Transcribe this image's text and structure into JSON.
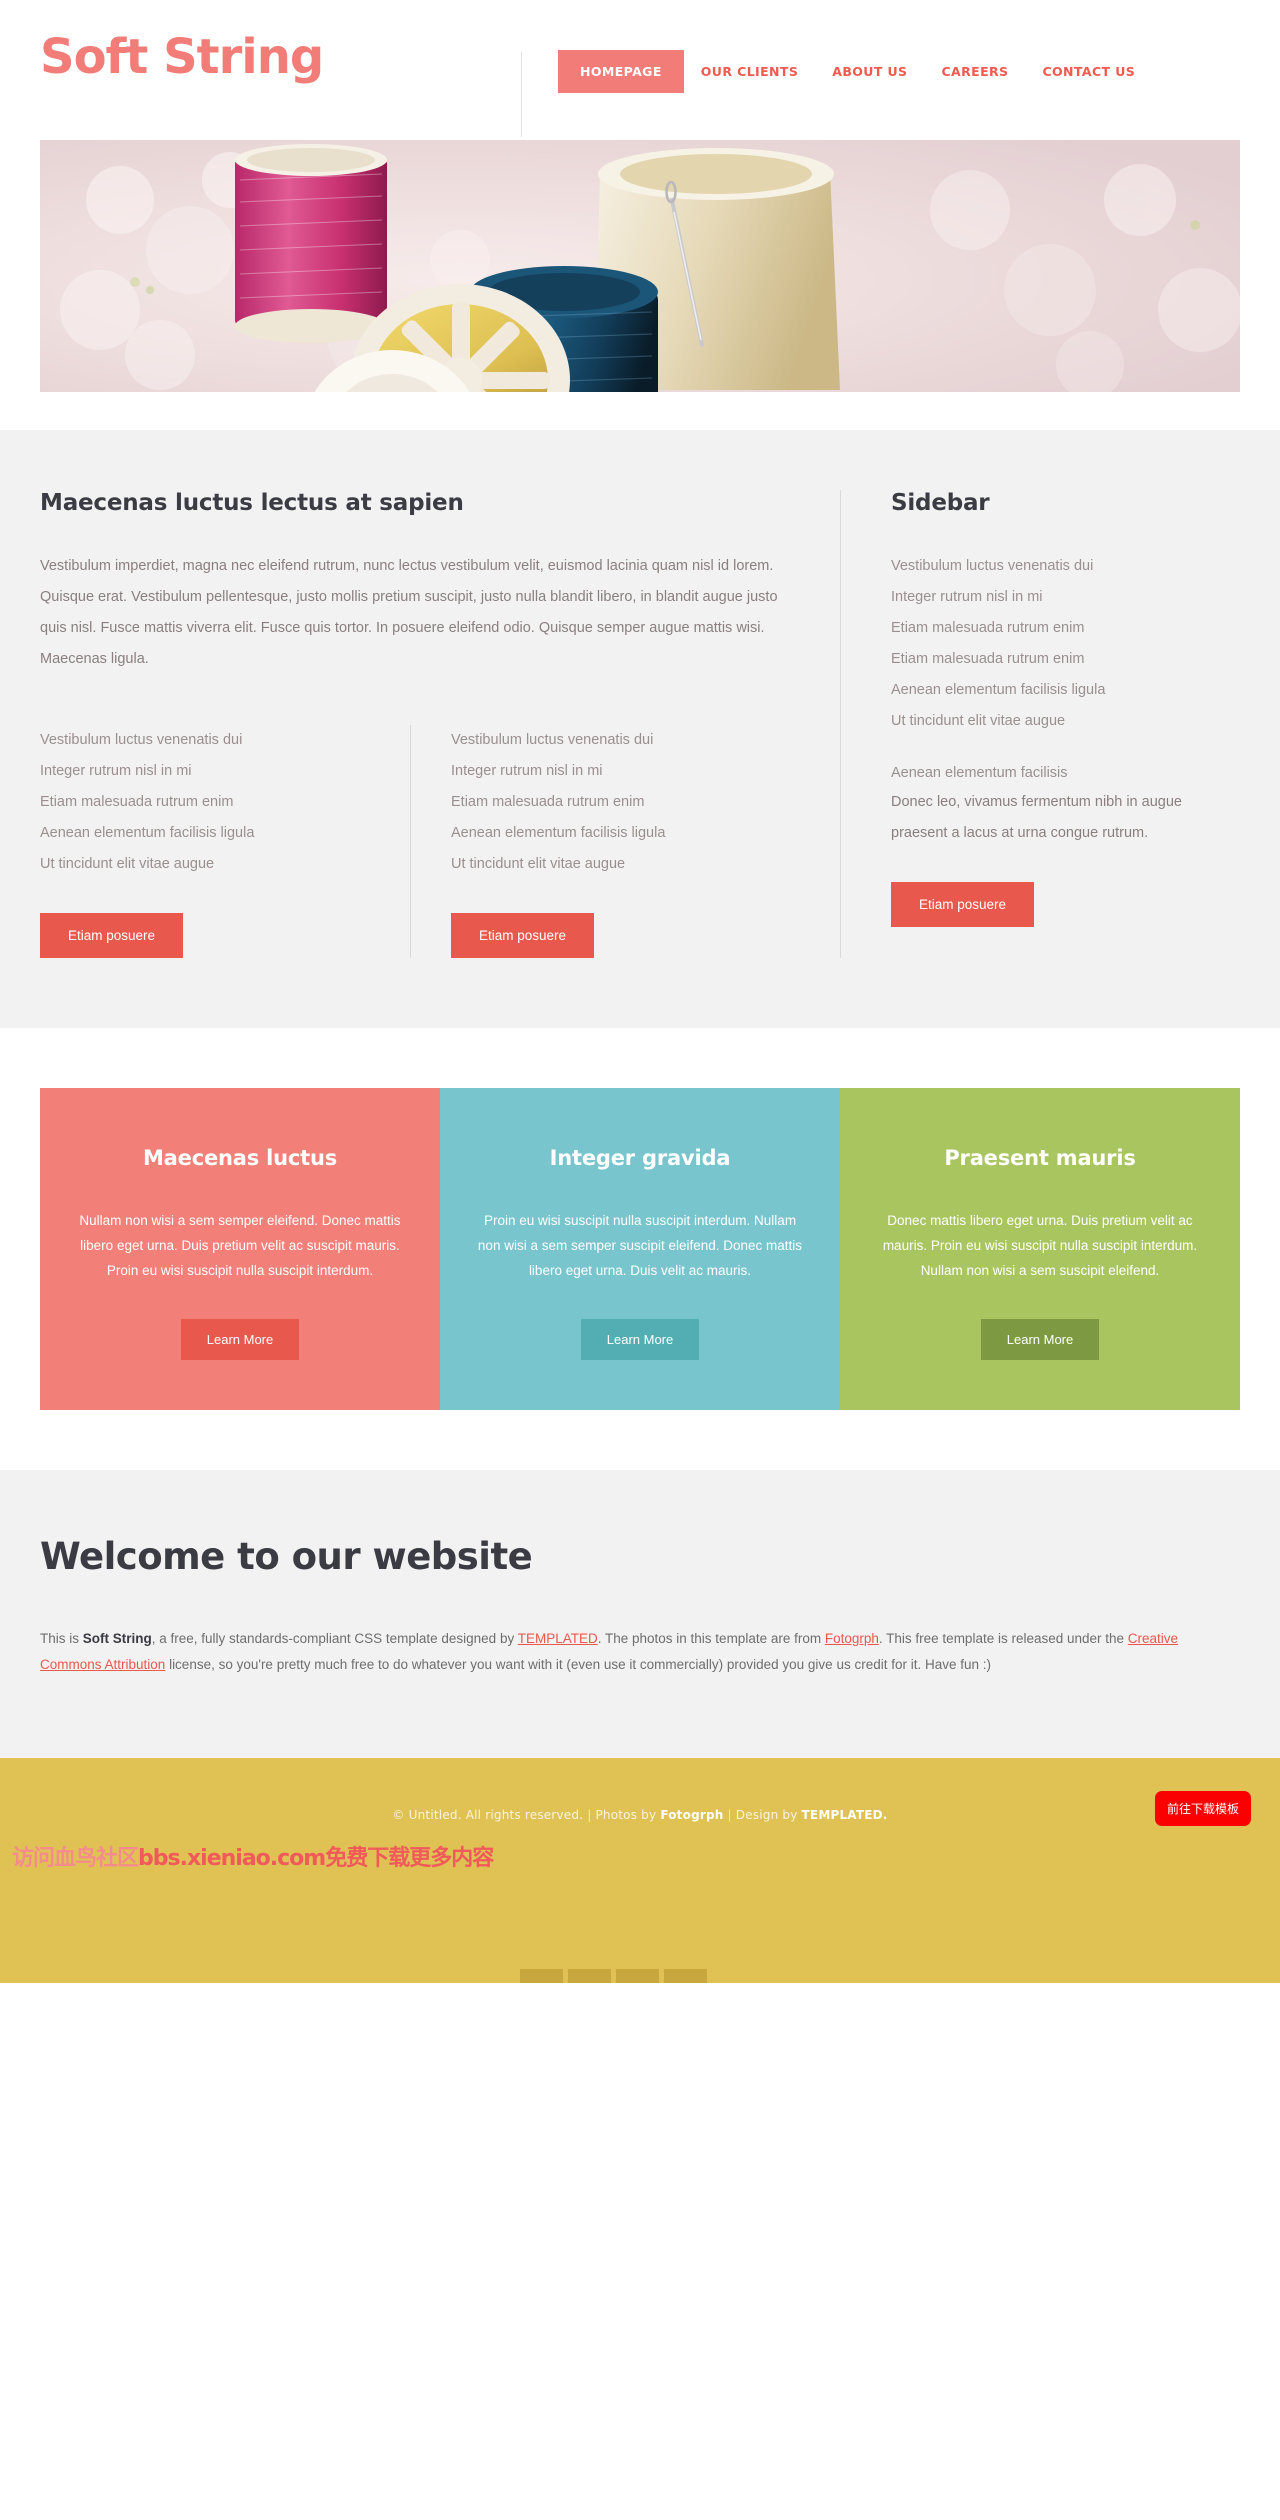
{
  "header": {
    "logo": "Soft String",
    "nav": [
      {
        "label": "HOMEPAGE",
        "active": true
      },
      {
        "label": "OUR CLIENTS",
        "active": false
      },
      {
        "label": "ABOUT US",
        "active": false
      },
      {
        "label": "CAREERS",
        "active": false
      },
      {
        "label": "CONTACT US",
        "active": false
      }
    ]
  },
  "banner": {
    "alt": "thread-spools-banner-image"
  },
  "main": {
    "heading": "Maecenas luctus lectus at sapien",
    "paragraph": "Vestibulum imperdiet, magna nec eleifend rutrum, nunc lectus vestibulum velit, euismod lacinia quam nisl id lorem. Quisque erat. Vestibulum pellentesque, justo mollis pretium suscipit, justo nulla blandit libero, in blandit augue justo quis nisl. Fusce mattis viverra elit. Fusce quis tortor. In posuere eleifend odio. Quisque semper augue mattis wisi. Maecenas ligula.",
    "list_left": [
      "Vestibulum luctus venenatis dui",
      "Integer rutrum nisl in mi",
      "Etiam malesuada rutrum enim",
      "Aenean elementum facilisis ligula",
      "Ut tincidunt elit vitae augue"
    ],
    "list_right": [
      "Vestibulum luctus venenatis dui",
      "Integer rutrum nisl in mi",
      "Etiam malesuada rutrum enim",
      "Aenean elementum facilisis ligula",
      "Ut tincidunt elit vitae augue"
    ],
    "button_left": "Etiam posuere",
    "button_right": "Etiam posuere"
  },
  "sidebar": {
    "heading": "Sidebar",
    "list": [
      "Vestibulum luctus venenatis dui",
      "Integer rutrum nisl in mi",
      "Etiam malesuada rutrum enim",
      "Etiam malesuada rutrum enim",
      "Aenean elementum facilisis ligula",
      "Ut tincidunt elit vitae augue"
    ],
    "subheading": "Aenean elementum facilisis",
    "paragraph": "Donec leo, vivamus fermentum nibh in augue praesent a lacus at urna congue rutrum.",
    "button": "Etiam posuere"
  },
  "boxes": [
    {
      "title": "Maecenas luctus",
      "text": "Nullam non wisi a sem semper eleifend. Donec mattis libero eget urna. Duis pretium velit ac suscipit mauris. Proin eu wisi suscipit nulla suscipit interdum.",
      "button": "Learn More",
      "bg": "#F28079",
      "button_bg": "#E8584C"
    },
    {
      "title": "Integer gravida",
      "text": "Proin eu wisi suscipit nulla suscipit interdum. Nullam non wisi a sem semper suscipit eleifend. Donec mattis libero eget urna. Duis velit ac mauris.",
      "button": "Learn More",
      "bg": "#78C5CE",
      "button_bg": "#53AEB4"
    },
    {
      "title": "Praesent mauris",
      "text": "Donec mattis libero eget urna. Duis pretium velit ac mauris. Proin eu wisi suscipit nulla suscipit interdum. Nullam non wisi a sem suscipit eleifend.",
      "button": "Learn More",
      "bg": "#A9C55F",
      "button_bg": "#7D9A42"
    }
  ],
  "welcome": {
    "heading": "Welcome to our website",
    "text_1": "This is ",
    "brand": "Soft String",
    "text_2": ", a free, fully standards-compliant CSS template designed by ",
    "link_templated": "TEMPLATED",
    "text_3": ". The photos in this template are from ",
    "link_fotogrph": "Fotogrph",
    "text_4": ". This free template is released under the ",
    "link_cc": "Creative Commons Attribution",
    "text_5": " license, so you're pretty much free to do whatever you want with it (even use it commercially) provided you give us credit for it. Have fun :)"
  },
  "footer": {
    "copyright": "© Untitled. All rights reserved.",
    "photos_prefix": "Photos by ",
    "photos_by": "Fotogrph",
    "design_prefix": "Design by ",
    "design_by": "TEMPLATED.",
    "download_button": "前往下载模板",
    "watermark_1": "访问血鸟社区",
    "watermark_2": "bbs.xieniao.com",
    "watermark_3": "免费下载更多内容"
  },
  "colors": {
    "accent": "#F27C77",
    "accent_dark": "#E8584C",
    "footer_bg": "#E0C254",
    "download_red": "#FB0000"
  }
}
